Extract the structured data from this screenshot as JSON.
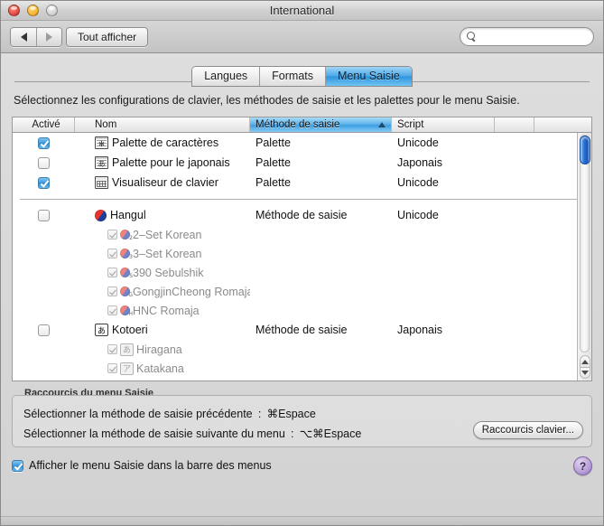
{
  "window": {
    "title": "International",
    "traffic": {
      "close": "close-button",
      "minimize": "minimize-button",
      "zoom": "zoom-button"
    }
  },
  "toolbar": {
    "back_label": "◀",
    "forward_label": "▶",
    "show_all_label": "Tout afficher",
    "search_value": "",
    "search_placeholder": ""
  },
  "tabs": [
    {
      "label": "Langues",
      "active": false
    },
    {
      "label": "Formats",
      "active": false
    },
    {
      "label": "Menu Saisie",
      "active": true
    }
  ],
  "description": "Sélectionnez les configurations de clavier, les méthodes de saisie et les palettes pour le menu Saisie.",
  "table": {
    "columns": [
      {
        "label": "Activé",
        "sorted": false
      },
      {
        "label": "Nom",
        "sorted": false
      },
      {
        "label": "Méthode de saisie",
        "sorted": true,
        "direction": "ascending"
      },
      {
        "label": "Script",
        "sorted": false
      }
    ],
    "rows": [
      {
        "checked": true,
        "icon": "character-palette-icon",
        "icon_glyph": "✻",
        "name": "Palette de caractères",
        "method": "Palette",
        "script": "Unicode",
        "kind": "top"
      },
      {
        "checked": false,
        "icon": "japanese-palette-icon",
        "icon_glyph": "あ",
        "name": "Palette pour le japonais",
        "method": "Palette",
        "script": "Japonais",
        "kind": "top"
      },
      {
        "checked": true,
        "icon": "keyboard-viewer-icon",
        "icon_glyph": "",
        "name": "Visualiseur de clavier",
        "method": "Palette",
        "script": "Unicode",
        "kind": "top"
      },
      {
        "separator": true
      },
      {
        "checked": false,
        "icon": "hangul-icon",
        "icon_glyph": "",
        "name": "Hangul",
        "method": "Méthode de saisie",
        "script": "Unicode",
        "kind": "top"
      },
      {
        "checked": true,
        "disabled": true,
        "icon": "hangul-sub-icon",
        "badge": "2",
        "name": "2–Set Korean",
        "method": "",
        "script": "",
        "kind": "sub"
      },
      {
        "checked": true,
        "disabled": true,
        "icon": "hangul-sub-icon",
        "badge": "3",
        "name": "3–Set Korean",
        "method": "",
        "script": "",
        "kind": "sub"
      },
      {
        "checked": true,
        "disabled": true,
        "icon": "hangul-sub-icon",
        "badge": "S",
        "name": "390 Sebulshik",
        "method": "",
        "script": "",
        "kind": "sub"
      },
      {
        "checked": true,
        "disabled": true,
        "icon": "hangul-sub-icon",
        "badge": "G",
        "name": "GongjinCheong Romaja",
        "method": "",
        "script": "",
        "kind": "sub"
      },
      {
        "checked": true,
        "disabled": true,
        "icon": "hangul-sub-icon",
        "badge": "H",
        "name": "HNC Romaja",
        "method": "",
        "script": "",
        "kind": "sub"
      },
      {
        "checked": false,
        "icon": "kotoeri-icon",
        "icon_glyph": "あ",
        "name": "Kotoeri",
        "method": "Méthode de saisie",
        "script": "Japonais",
        "kind": "top"
      },
      {
        "checked": true,
        "disabled": true,
        "icon": "hiragana-icon",
        "icon_glyph": "あ",
        "name": "Hiragana",
        "method": "",
        "script": "",
        "kind": "sub"
      },
      {
        "checked": true,
        "disabled": true,
        "icon": "katakana-icon",
        "icon_glyph": "ア",
        "name": "Katakana",
        "method": "",
        "script": "",
        "kind": "sub"
      }
    ]
  },
  "shortcuts": {
    "group_title": "Raccourcis du menu Saisie",
    "line1": "Sélectionner la méthode de saisie précédente : ⌘Espace",
    "line2": "Sélectionner la méthode de saisie suivante du menu : ⌥⌘Espace",
    "button_label": "Raccourcis clavier..."
  },
  "footer": {
    "checkbox_checked": true,
    "label": "Afficher le menu Saisie dans la barre des menus",
    "help_label": "?"
  },
  "colors": {
    "accent": "#3f9fe3",
    "tab_active": "#2e94de",
    "scrollbar_thumb": "#2a72d4",
    "help_button": "#b79ed6"
  }
}
